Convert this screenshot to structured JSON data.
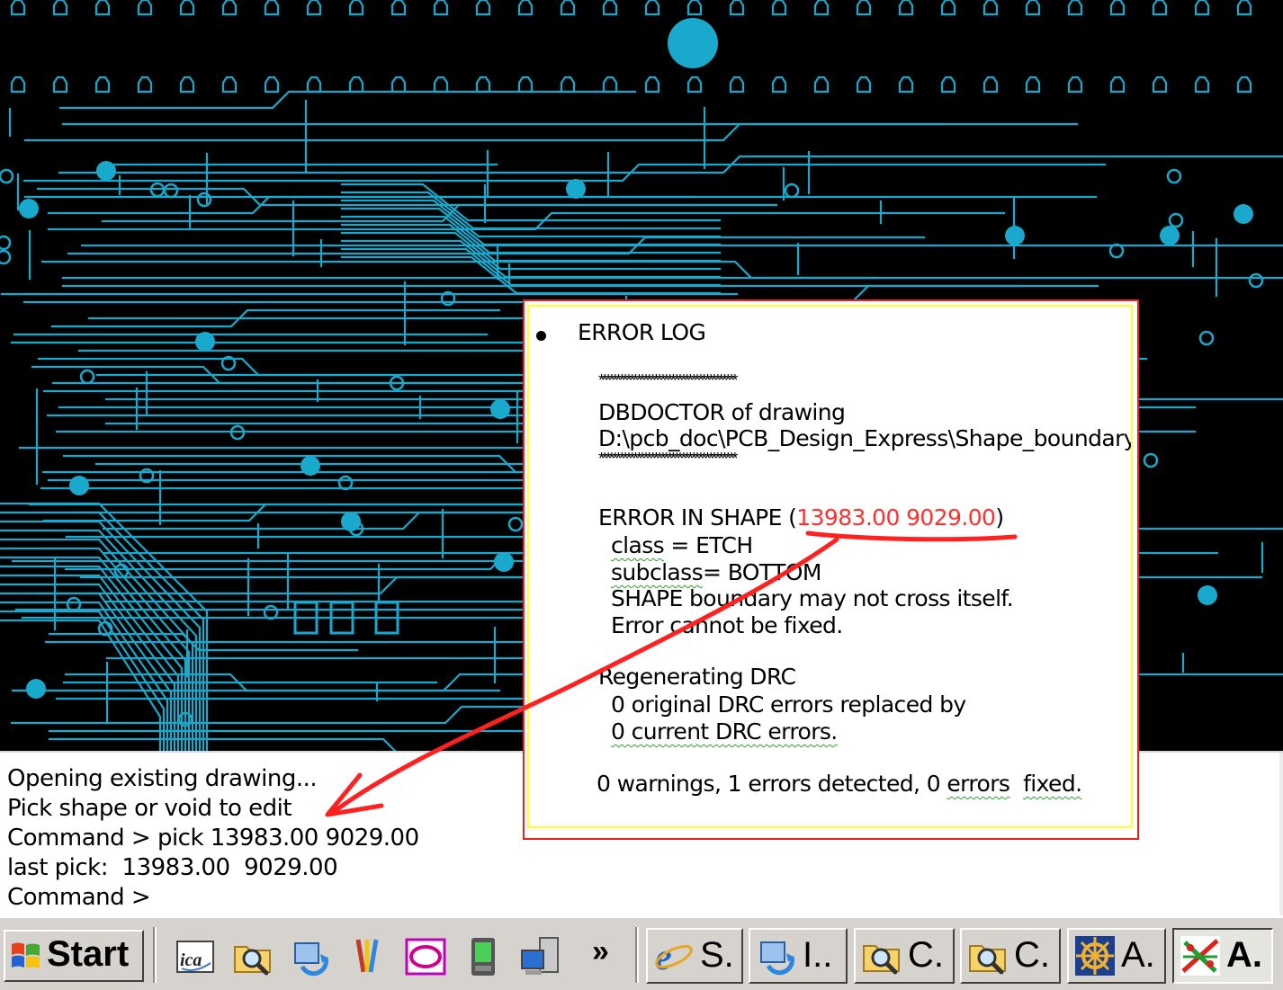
{
  "colors": {
    "trace": "#19a9cc",
    "canvas": "#000000",
    "annotation": "#ff2020",
    "highlight": "#ffff30"
  },
  "console": {
    "lines": [
      "Opening existing drawing...",
      "Pick shape or void to edit",
      "Command > pick 13983.00 9029.00",
      "last pick:  13983.00  9029.00",
      "Command >"
    ]
  },
  "error_log": {
    "title": "ERROR LOG",
    "stars": "****************************************",
    "dbdoctor_line": "DBDOCTOR of drawing",
    "path": "D:\\pcb_doc\\PCB_Design_Express\\Shape_boundary",
    "error_prefix": "ERROR IN SHAPE (",
    "coords": "13983.00 9029.00",
    "error_suffix": ")",
    "class_key": "class",
    "class_value": " = ETCH",
    "subclass_key": "subclass",
    "subclass_value": "= BOTTOM",
    "msg1": "SHAPE boundary may not cross itself.",
    "msg2": "Error cannot be fixed.",
    "regen": "Regenerating DRC",
    "drc1": "0 original DRC errors replaced by",
    "drc2": "0 current DRC errors.",
    "summary_main": "0 warnings, 1 errors detected, 0 ",
    "summary_errors": "errors",
    "summary_fixed": "fixed."
  },
  "taskbar": {
    "start_label": "Start",
    "chevron": "»",
    "quick_launch_icons": [
      "ica-icon",
      "search-folder-icon",
      "sync-icon",
      "paint-icon",
      "outlook-icon",
      "pda-icon",
      "computer-icon"
    ],
    "tasks": [
      {
        "label": "S.",
        "icon": "ie-icon"
      },
      {
        "label": "I..",
        "icon": "sync-icon"
      },
      {
        "label": "C.",
        "icon": "search-folder-icon"
      },
      {
        "label": "C.",
        "icon": "search-folder-icon"
      },
      {
        "label": "A.",
        "icon": "helm-icon"
      },
      {
        "label": "A.",
        "icon": "allegro-icon",
        "active": true
      }
    ]
  }
}
